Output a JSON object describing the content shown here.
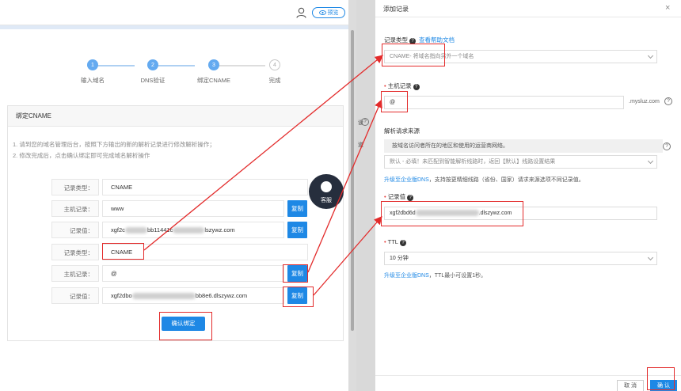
{
  "topbar": {
    "preview_label": "预览"
  },
  "steps": [
    {
      "num": "1",
      "label": "输入域名"
    },
    {
      "num": "2",
      "label": "DNS验证"
    },
    {
      "num": "3",
      "label": "绑定CNAME"
    },
    {
      "num": "4",
      "label": "完成"
    }
  ],
  "card": {
    "title": "绑定CNAME",
    "notes": [
      "1. 请到您的域名管理后台，按照下方输出的新的解析记录进行修改解析操作；",
      "2. 修改完成后，点击确认绑定即可完成域名解析操作"
    ],
    "rows": [
      {
        "label": "记录类型：",
        "value": "CNAME"
      },
      {
        "label": "主机记录：",
        "value": "www"
      },
      {
        "label": "记录值：",
        "value_pre": "xgf2c",
        "value_mid": "bb11441c",
        "value_post": "lszywz.com"
      },
      {
        "label": "记录类型：",
        "value": "CNAME"
      },
      {
        "label": "主机记录：",
        "value": "@"
      },
      {
        "label": "记录值：",
        "value_pre": "xgf2dbo",
        "value_post": "bb8e6.dlszywz.com"
      }
    ],
    "copy_label": "复制",
    "confirm_label": "确认绑定"
  },
  "kefu": {
    "label": "客服"
  },
  "gutter": {
    "frag1": "设",
    "frag2": "道"
  },
  "dialog": {
    "title": "添加记录",
    "close": "×",
    "record_type_label": "记录类型",
    "help_link": "查看帮助文档",
    "record_type_value": "CNAME- 将域名指向另外一个域名",
    "host_label": "主机记录",
    "host_value": "@",
    "host_suffix": ".mysluz.com",
    "line_label": "解析请求来源",
    "line_info": "按域名访问者所在的地区和使用的运营商网络。",
    "line_value": "默认 - 必填！未匹配到智能解析线路时，返回【默认】线路设置结果",
    "line_hint_link": "升级至企业版DNS",
    "line_hint_text": "，支持按更精细线路（省份、国家）请求来源选项不同记录值。",
    "value_label": "记录值",
    "value_pre": "xgf2dbd6d",
    "value_post": ".dlszywz.com",
    "ttl_label": "TTL",
    "ttl_value": "10 分钟",
    "ttl_hint_link": "升级至企业版DNS",
    "ttl_hint_text": "，TTL最小可设置1秒。",
    "cancel_label": "取 消",
    "ok_label": "确 认"
  }
}
